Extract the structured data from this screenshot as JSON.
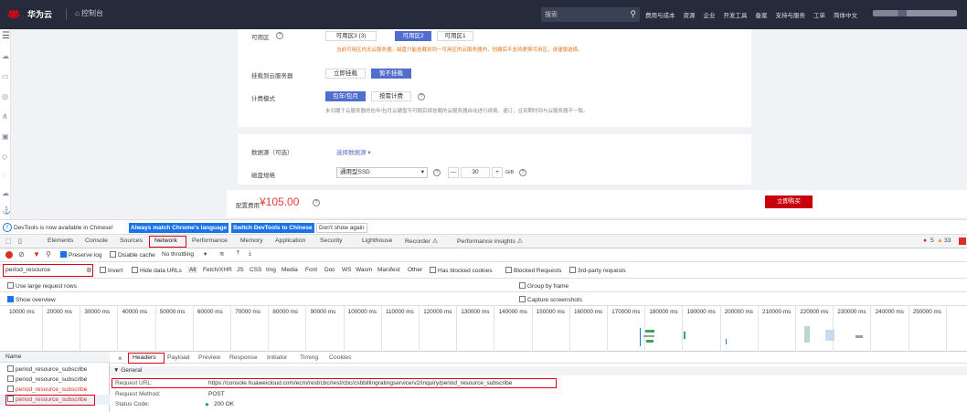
{
  "topbar": {
    "brand": "华为云",
    "home": "⌂ 控制台",
    "search_placeholder": "搜索",
    "nav": [
      "费用与成本",
      "资源",
      "企业",
      "开发工具",
      "备案",
      "支持与服务",
      "工单",
      "简体中文"
    ]
  },
  "leftbar_icons": [
    "menu-icon",
    "cloud-icon",
    "server-icon",
    "database-icon",
    "network-icon",
    "storage-icon",
    "security-icon",
    "monitor-icon",
    "cloud-alt-icon",
    "anchor-icon"
  ],
  "form": {
    "az_label": "可用区",
    "az_options": [
      "可用区3 (3)",
      "可用区2",
      "可用区1"
    ],
    "az_warning": "当前可用区内无云服务器。磁盘只能挂载到同一可用区的云服务器内，创建后不支持更换可用区，请谨慎选择。",
    "attach_label": "挂载到云服务器",
    "attach_options": [
      "立即挂载",
      "暂不挂载"
    ],
    "billing_label": "计费模式",
    "billing_options": [
      "包年/包月",
      "按需计费"
    ],
    "billing_hint": "未归属于云服务器的包年/包月云硬盘不可随后续挂载的云服务器自动进行续费、退订，且到期时间与云服务器不一致。",
    "source_label": "数据源（可选）",
    "source_link": "选择数据源 ▾",
    "spec_label": "磁盘规格",
    "spec_value": "通用型SSD",
    "spec_arrow": "▾",
    "size_value": "30",
    "size_unit": "GiB",
    "minus": "—",
    "plus": "+",
    "price_label": "配置费用",
    "price_value": "¥105.00",
    "buy_button": "立即购买"
  },
  "infobar": {
    "message": "DevTools is now available in Chinese!",
    "btn1": "Always match Chrome's language",
    "btn2": "Switch DevTools to Chinese",
    "btn3": "Don't show again"
  },
  "devtools_tabs": [
    "Elements",
    "Console",
    "Sources",
    "Network",
    "Performance",
    "Memory",
    "Application",
    "Security",
    "Lighthouse",
    "Recorder ⚠",
    "Performance insights ⚠"
  ],
  "counts": {
    "errors": "5",
    "warnings": "33"
  },
  "toolbar": {
    "preserve_log": "Preserve log",
    "disable_cache": "Disable cache",
    "throttling": "No throttling"
  },
  "filter": {
    "value": "period_resource",
    "invert": "Invert",
    "hide_data": "Hide data URLs",
    "types": [
      "All",
      "Fetch/XHR",
      "JS",
      "CSS",
      "Img",
      "Media",
      "Font",
      "Doc",
      "WS",
      "Wasm",
      "Manifest",
      "Other"
    ],
    "blocked_cookies": "Has blocked cookies",
    "blocked_requests": "Blocked Requests",
    "third_party": "3rd-party requests"
  },
  "options": {
    "large_rows": "Use large request rows",
    "group_frame": "Group by frame",
    "show_overview": "Show overview",
    "capture": "Capture screenshots"
  },
  "timeline_ticks": [
    "10000 ms",
    "20000 ms",
    "30000 ms",
    "40000 ms",
    "50000 ms",
    "60000 ms",
    "70000 ms",
    "80000 ms",
    "90000 ms",
    "100000 ms",
    "110000 ms",
    "120000 ms",
    "130000 ms",
    "140000 ms",
    "150000 ms",
    "160000 ms",
    "170000 ms",
    "180000 ms",
    "190000 ms",
    "200000 ms",
    "210000 ms",
    "220000 ms",
    "230000 ms",
    "240000 ms",
    "250000 ms"
  ],
  "requests": {
    "header": "Name",
    "items": [
      "period_resource_subscribe",
      "period_resource_subscribe",
      "period_resource_subscribe",
      "period_resource_subscribe"
    ]
  },
  "detail_tabs": [
    "Headers",
    "Payload",
    "Preview",
    "Response",
    "Initiator",
    "Timing",
    "Cookies"
  ],
  "general": {
    "title": "▼ General",
    "url_key": "Request URL:",
    "url_val": "https://console.huaweicloud.com/ecm/rest/cbc/rest/cbc/csbbillingratingservice/v2/inquiry/period_resource_subscribe",
    "method_key": "Request Method:",
    "method_val": "POST",
    "status_key": "Status Code:",
    "status_val": "200 OK"
  }
}
